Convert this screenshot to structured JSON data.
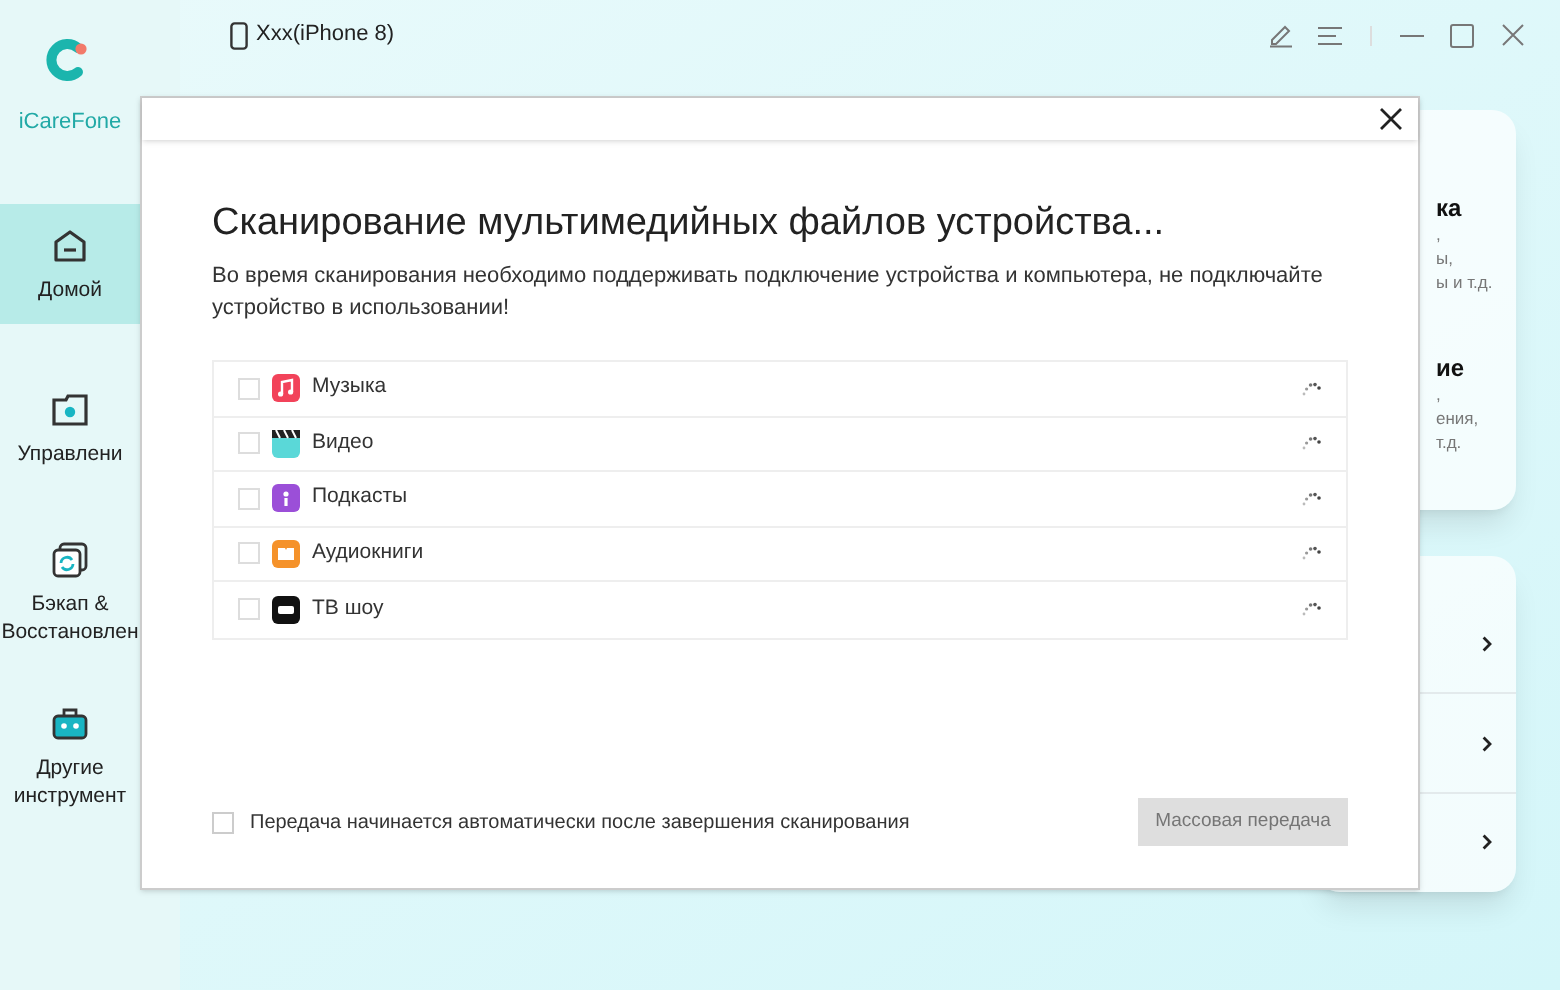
{
  "app": {
    "name": "iCareFone"
  },
  "device": {
    "name": "Xxx(iPhone 8)"
  },
  "sidebar": {
    "items": [
      {
        "label": "Домой",
        "kind": "home",
        "selected": true
      },
      {
        "label": "Управлени",
        "kind": "manage",
        "selected": false
      },
      {
        "label": "Бэкап & Восстановлен",
        "kind": "backup",
        "selected": false
      },
      {
        "label": "Другие инструмент",
        "kind": "tools",
        "selected": false
      }
    ]
  },
  "feature_cards": [
    {
      "title": "ка",
      "lines": [
        ",",
        "ы,",
        "ы и т.д."
      ]
    },
    {
      "title": "ие",
      "lines": [
        ",",
        "ения,",
        "т.д."
      ]
    }
  ],
  "dialog": {
    "title": "Сканирование мультимедийных файлов устройства...",
    "description": "Во время сканирования необходимо поддерживать подключение устройства и компьютера, не подключайте устройство в использовании!",
    "categories": [
      {
        "label": "Музыка",
        "kind": "music",
        "checked": false
      },
      {
        "label": "Видео",
        "kind": "video",
        "checked": false
      },
      {
        "label": "Подкасты",
        "kind": "podcasts",
        "checked": false
      },
      {
        "label": "Аудиокниги",
        "kind": "books",
        "checked": false
      },
      {
        "label": "ТВ шоу",
        "kind": "tv",
        "checked": false
      }
    ],
    "auto_transfer": {
      "label": "Передача начинается автоматически после завершения сканирования",
      "checked": false
    },
    "button": {
      "label": "Массовая передача",
      "disabled": true
    }
  }
}
